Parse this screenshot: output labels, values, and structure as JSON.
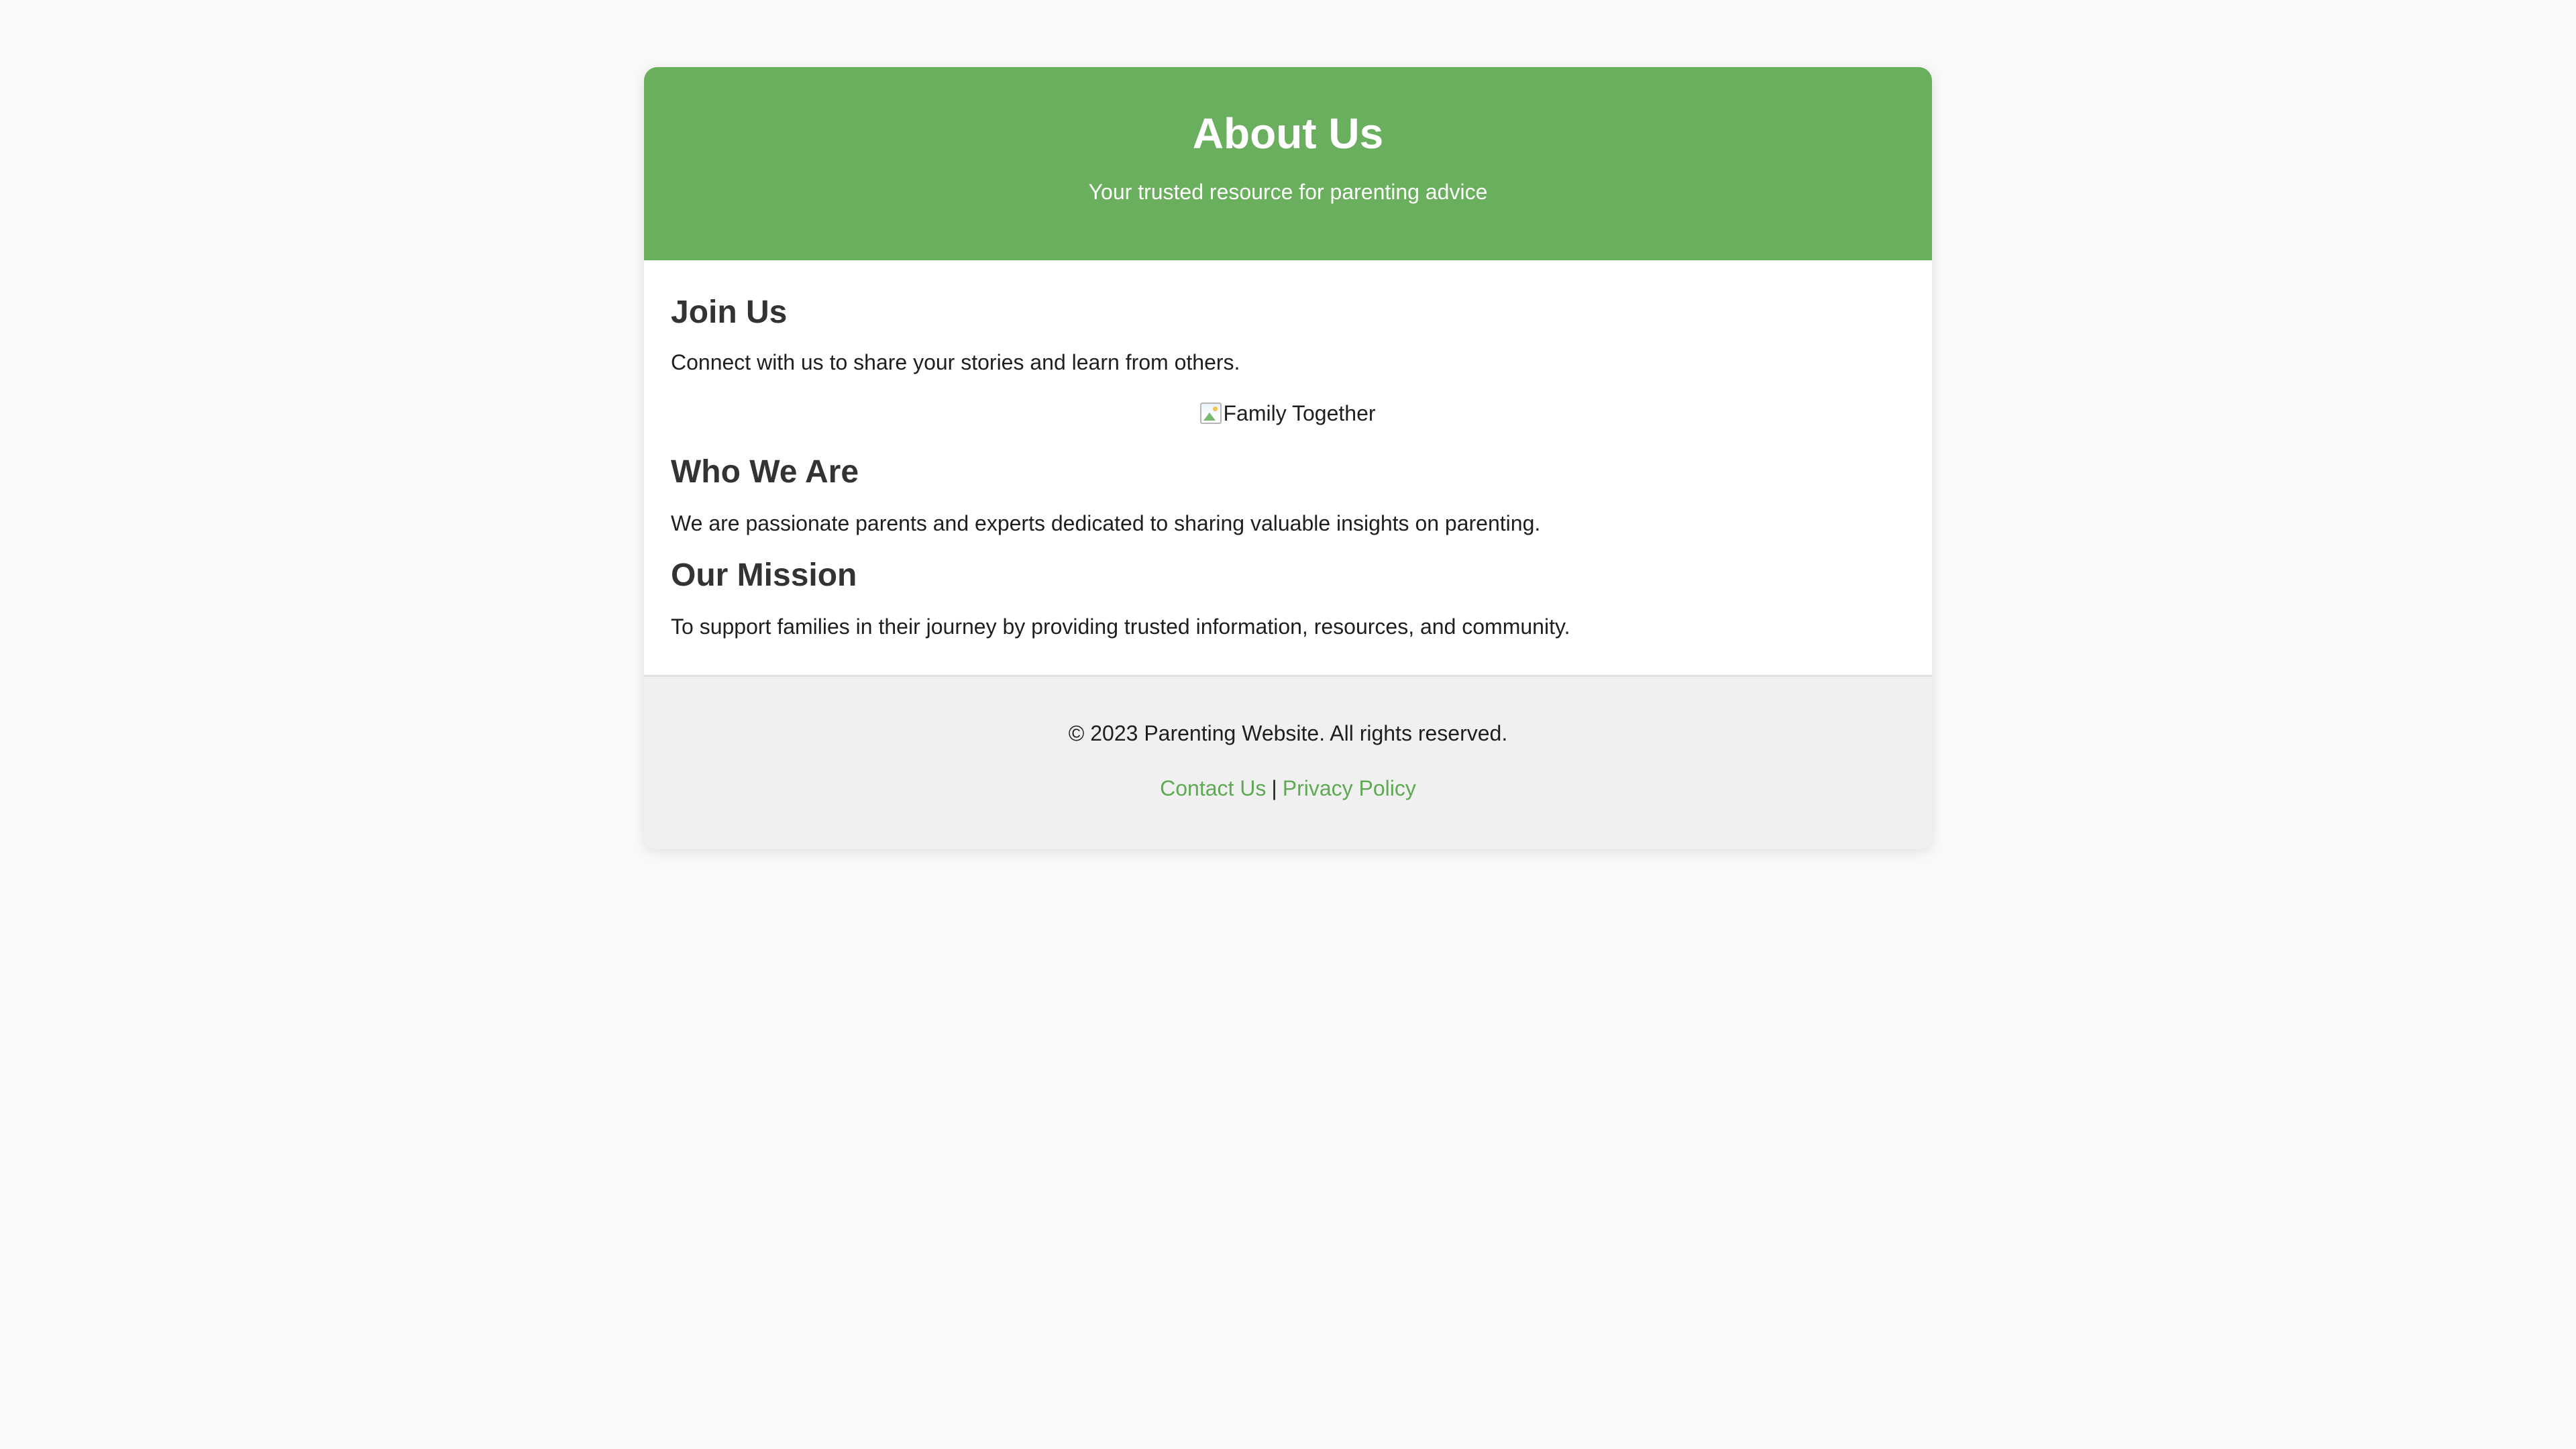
{
  "header": {
    "title": "About Us",
    "subtitle": "Your trusted resource for parenting advice"
  },
  "sections": {
    "join": {
      "heading": "Join Us",
      "text": "Connect with us to share your stories and learn from others.",
      "image_alt": "Family Together",
      "image_icon": "broken-image-icon"
    },
    "who": {
      "heading": "Who We Are",
      "text": "We are passionate parents and experts dedicated to sharing valuable insights on parenting."
    },
    "mission": {
      "heading": "Our Mission",
      "text": "To support families in their journey by providing trusted information, resources, and community."
    }
  },
  "footer": {
    "copyright": "© 2023 Parenting Website. All rights reserved.",
    "links": {
      "contact": "Contact Us",
      "separator": "|",
      "privacy": "Privacy Policy"
    }
  },
  "colors": {
    "header_background": "#6aaf5d",
    "link": "#5daa52",
    "page_background": "#f9f9f9",
    "footer_background": "#f0f0f0"
  }
}
